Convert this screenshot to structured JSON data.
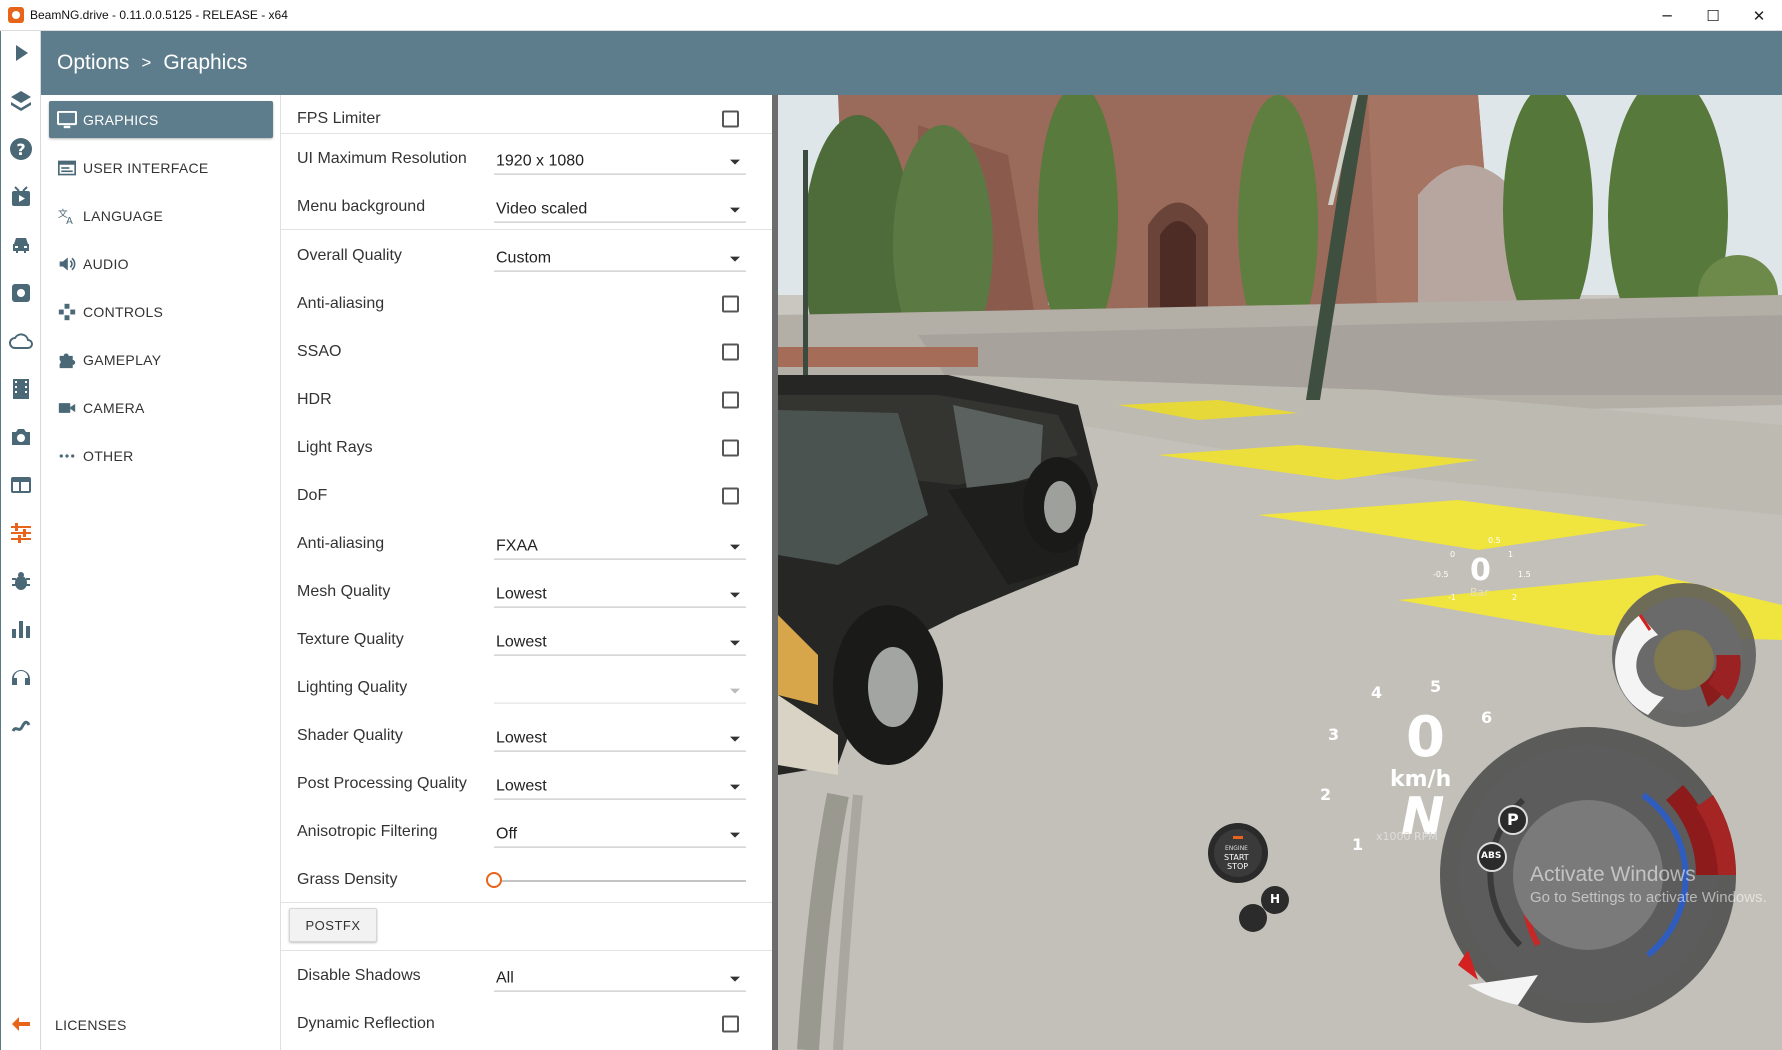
{
  "window": {
    "title": "BeamNG.drive - 0.11.0.0.5125 - RELEASE - x64",
    "minimize": "─",
    "maximize": "☐",
    "close": "✕"
  },
  "rail": {
    "items": [
      "play-icon",
      "layers-icon",
      "help-icon",
      "video-icon",
      "car-icon",
      "gear-icon",
      "cloud-icon",
      "film-icon",
      "camera-icon",
      "layout-icon",
      "sliders-icon",
      "bug-icon",
      "stats-icon",
      "headset-icon",
      "route-icon",
      "back-arrow-icon"
    ],
    "active": "sliders-icon",
    "accent": "#e8641b"
  },
  "header": {
    "root": "Options",
    "separator": ">",
    "current": "Graphics",
    "background": "#5e7d8c"
  },
  "categories": [
    {
      "label": "GRAPHICS",
      "icon": "monitor-icon",
      "active": true
    },
    {
      "label": "USER INTERFACE",
      "icon": "window-icon",
      "active": false
    },
    {
      "label": "LANGUAGE",
      "icon": "translate-icon",
      "active": false
    },
    {
      "label": "AUDIO",
      "icon": "speaker-icon",
      "active": false
    },
    {
      "label": "CONTROLS",
      "icon": "gamepad-icon",
      "active": false
    },
    {
      "label": "GAMEPLAY",
      "icon": "puzzle-icon",
      "active": false
    },
    {
      "label": "CAMERA",
      "icon": "videocam-icon",
      "active": false
    },
    {
      "label": "OTHER",
      "icon": "more-icon",
      "active": false
    }
  ],
  "licenses": "LICENSES",
  "settings": {
    "fps_limiter": {
      "label": "FPS Limiter",
      "checked": false
    },
    "ui_max_resolution": {
      "label": "UI Maximum Resolution",
      "value": "1920 x 1080"
    },
    "menu_background": {
      "label": "Menu background",
      "value": "Video scaled"
    },
    "overall_quality": {
      "label": "Overall Quality",
      "value": "Custom"
    },
    "anti_aliasing_toggle": {
      "label": "Anti-aliasing",
      "checked": false
    },
    "ssao": {
      "label": "SSAO",
      "checked": false
    },
    "hdr": {
      "label": "HDR",
      "checked": false
    },
    "light_rays": {
      "label": "Light Rays",
      "checked": false
    },
    "dof": {
      "label": "DoF",
      "checked": false
    },
    "anti_aliasing_mode": {
      "label": "Anti-aliasing",
      "value": "FXAA"
    },
    "mesh_quality": {
      "label": "Mesh Quality",
      "value": "Lowest"
    },
    "texture_quality": {
      "label": "Texture Quality",
      "value": "Lowest"
    },
    "lighting_quality": {
      "label": "Lighting Quality",
      "value": ""
    },
    "shader_quality": {
      "label": "Shader Quality",
      "value": "Lowest"
    },
    "post_processing_quality": {
      "label": "Post Processing Quality",
      "value": "Lowest"
    },
    "anisotropic_filtering": {
      "label": "Anisotropic Filtering",
      "value": "Off"
    },
    "grass_density": {
      "label": "Grass Density",
      "level": 0
    },
    "postfx_button": "POSTFX",
    "disable_shadows": {
      "label": "Disable Shadows",
      "value": "All"
    },
    "dynamic_reflection": {
      "label": "Dynamic Reflection",
      "checked": false
    }
  },
  "hud": {
    "boost": {
      "value": "0",
      "unit": "Bar",
      "ticks": [
        "0.5",
        "0",
        "1",
        "-0.5",
        "1.5",
        "-1",
        "2"
      ]
    },
    "speedo": {
      "speed": "0",
      "speed_unit": "km/h",
      "gear": "N",
      "rpm_unit": "x1000 RPM",
      "rpm_ticks": [
        "1",
        "2",
        "3",
        "4",
        "5",
        "6"
      ]
    },
    "engine_button": {
      "line1": "ENGINE",
      "line2": "START",
      "line3": "STOP"
    },
    "park_label": "P",
    "abs_label": "ABS",
    "handbrake_label": "H"
  },
  "watermark": {
    "line1": "Activate Windows",
    "line2": "Go to Settings to activate Windows."
  }
}
